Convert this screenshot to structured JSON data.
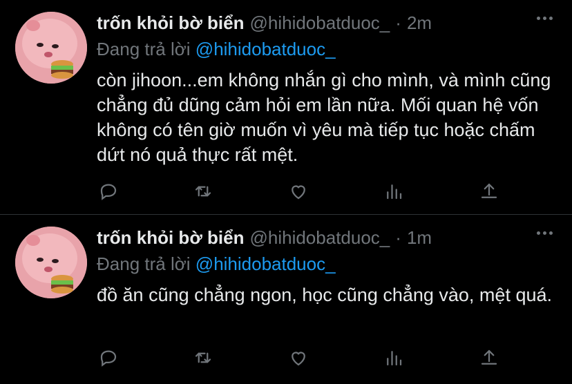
{
  "tweets": [
    {
      "display_name": "trốn khỏi bờ biển",
      "handle": "@hihidobatduoc_",
      "separator": "·",
      "time": "2m",
      "replying_prefix": "Đang trả lời",
      "replying_to": "@hihidobatduoc_",
      "text": "còn jihoon...em không nhắn gì cho mình, và mình cũng chẳng đủ dũng cảm hỏi em lần nữa. Mối quan hệ vốn không có tên giờ muốn vì yêu mà tiếp tục hoặc chấm dứt nó quả thực rất mệt."
    },
    {
      "display_name": "trốn khỏi bờ biển",
      "handle": "@hihidobatduoc_",
      "separator": "·",
      "time": "1m",
      "replying_prefix": "Đang trả lời",
      "replying_to": "@hihidobatduoc_",
      "text": "đồ ăn cũng chẳng ngon, học cũng chẳng vào, mệt quá."
    }
  ],
  "icons": {
    "reply": "reply-icon",
    "retweet": "retweet-icon",
    "like": "like-icon",
    "views": "analytics-icon",
    "share": "share-icon",
    "more": "more-icon"
  },
  "colors": {
    "background": "#000000",
    "text": "#e7e9ea",
    "muted": "#71767b",
    "link": "#1d9bf0",
    "divider": "#2f3336"
  }
}
